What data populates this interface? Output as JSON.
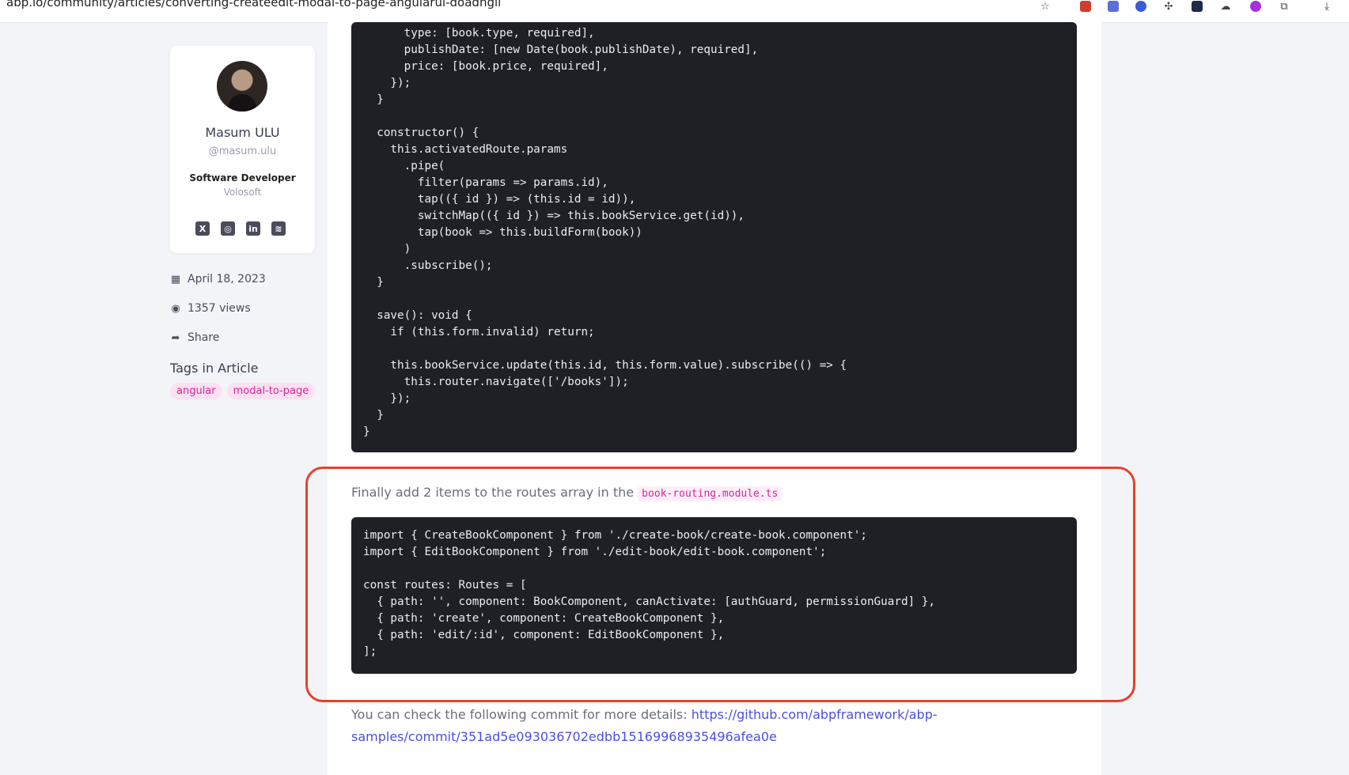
{
  "browser": {
    "url": "abp.io/community/articles/converting-createedit-modal-to-page-angularui-doadhgil"
  },
  "author": {
    "name": "Masum ULU",
    "handle": "@masum.ulu",
    "role": "Software Developer",
    "company": "Volosoft",
    "social_icons": [
      "x-icon",
      "github-icon",
      "linkedin-icon",
      "rss-icon"
    ]
  },
  "meta": {
    "date": "April 18, 2023",
    "views": "1357 views",
    "share": "Share"
  },
  "tags": {
    "title": "Tags in Article",
    "items": [
      "angular",
      "modal-to-page"
    ]
  },
  "article": {
    "code_top": "      type: [book.type, required],\n      publishDate: [new Date(book.publishDate), required],\n      price: [book.price, required],\n    });\n  }\n\n  constructor() {\n    this.activatedRoute.params\n      .pipe(\n        filter(params => params.id),\n        tap(({ id }) => (this.id = id)),\n        switchMap(({ id }) => this.bookService.get(id)),\n        tap(book => this.buildForm(book))\n      )\n      .subscribe();\n  }\n\n  save(): void {\n    if (this.form.invalid) return;\n\n    this.bookService.update(this.id, this.form.value).subscribe(() => {\n      this.router.navigate(['/books']);\n    });\n  }\n}",
    "routes_intro": "Finally add 2 items to the routes array in the",
    "routes_file": "book-routing.module.ts",
    "code_routes": "import { CreateBookComponent } from './create-book/create-book.component';\nimport { EditBookComponent } from './edit-book/edit-book.component';\n\nconst routes: Routes = [\n  { path: '', component: BookComponent, canActivate: [authGuard, permissionGuard] },\n  { path: 'create', component: CreateBookComponent },\n  { path: 'edit/:id', component: EditBookComponent },\n];",
    "commit_intro": "You can check the following commit for more details:",
    "commit_link": "https://github.com/abpframework/abp-samples/commit/351ad5e093036702edbb15169968935496afea0e"
  },
  "colors": {
    "highlight": "#e8402a",
    "tag_bg": "#fde0f1",
    "tag_fg": "#d6249f",
    "link": "#4b4fe0",
    "code_bg": "#1f1f26"
  }
}
